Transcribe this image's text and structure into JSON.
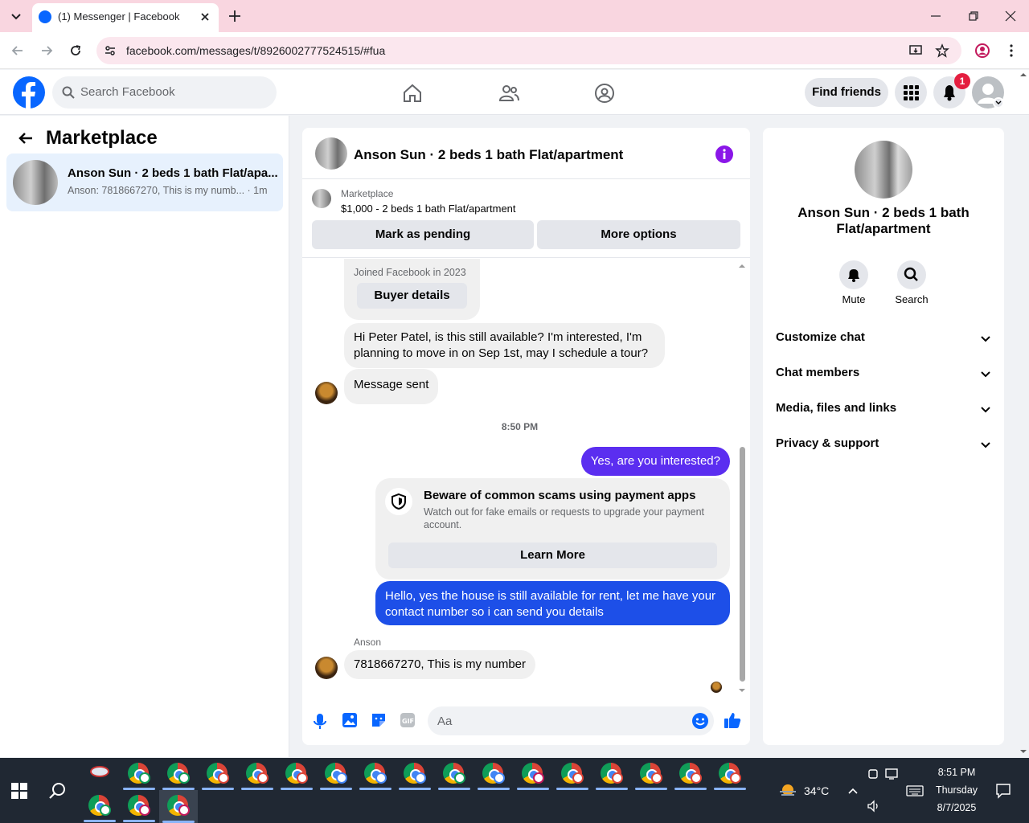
{
  "browser": {
    "tab_title": "(1) Messenger | Facebook",
    "url": "facebook.com/messages/t/8926002777524515/#fua"
  },
  "fb_header": {
    "search_placeholder": "Search Facebook",
    "find_friends": "Find friends",
    "notification_count": "1",
    "brand_color": "#0866ff"
  },
  "left": {
    "title": "Marketplace",
    "conversation": {
      "name": "Anson Sun · 2 beds 1 bath Flat/apa...",
      "preview": "Anson: 7818667270, This is my numb... · 1m"
    }
  },
  "chat": {
    "title": "Anson Sun · 2 beds 1 bath Flat/apartment",
    "marketplace_label": "Marketplace",
    "listing": "$1,000 - 2 beds 1 bath Flat/apartment",
    "mark_pending": "Mark as pending",
    "more_options": "More options",
    "joined": "Joined Facebook in 2023",
    "buyer_details": "Buyer details",
    "msg_1": "Hi Peter Patel, is this still available? I'm interested, I'm planning to move in on Sep 1st, may I schedule a tour?",
    "msg_sent": "Message sent",
    "timestamp": "8:50 PM",
    "reply_1": "Yes, are you interested?",
    "scam_title": "Beware of common scams using payment apps",
    "scam_body": "Watch out for fake emails or requests to upgrade your payment account.",
    "learn_more": "Learn More",
    "reply_2": "Hello, yes the house is still available for rent, let me have your contact number so i can send you details",
    "sender_label": "Anson",
    "msg_2": "7818667270, This is my number",
    "composer_placeholder": "Aa",
    "accent_color": "#5b2ef0"
  },
  "right": {
    "title": "Anson Sun · 2 beds 1 bath Flat/apartment",
    "mute": "Mute",
    "search": "Search",
    "sections": [
      "Customize chat",
      "Chat members",
      "Media, files and links",
      "Privacy & support"
    ]
  },
  "taskbar": {
    "temperature": "34°C",
    "time": "8:51 PM",
    "day": "Thursday",
    "date": "8/7/2025"
  }
}
